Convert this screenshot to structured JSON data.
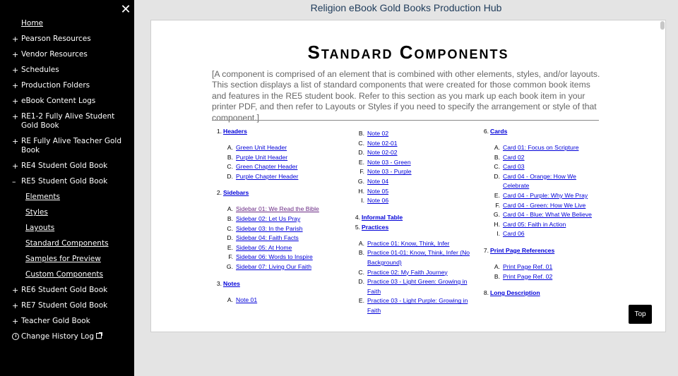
{
  "sidebar": {
    "close_label": "✕",
    "items": [
      {
        "label": "Home",
        "mark": ""
      },
      {
        "label": "Pearson Resources",
        "mark": "+"
      },
      {
        "label": "Vendor Resources",
        "mark": "+"
      },
      {
        "label": "Schedules",
        "mark": "+"
      },
      {
        "label": "Production Folders",
        "mark": "+"
      },
      {
        "label": "eBook Content Logs",
        "mark": "+"
      },
      {
        "label": "RE1-2 Fully Alive Student Gold Book",
        "mark": "+"
      },
      {
        "label": "RE Fully Alive Teacher Gold Book",
        "mark": "+"
      },
      {
        "label": "RE4 Student Gold Book",
        "mark": "+"
      },
      {
        "label": "RE5 Student Gold Book",
        "mark": "–"
      },
      {
        "label": "RE6 Student Gold Book",
        "mark": "+"
      },
      {
        "label": "RE7 Student Gold Book",
        "mark": "+"
      },
      {
        "label": "Teacher Gold Book",
        "mark": "+"
      },
      {
        "label": "Change History Log",
        "mark": ""
      }
    ],
    "re5_sub": [
      "Elements",
      "Styles",
      "Layouts",
      "Standard Components",
      "Samples for Preview",
      "Custom Components"
    ]
  },
  "header": {
    "title": "Religion eBook Gold Books Production Hub"
  },
  "main": {
    "title": "Standard Components",
    "intro": "[A component is comprised of an element that is combined with other elements, styles, and/or layouts. This section displays a list of standard components that were created for those common book items and features in the RE5 student book. Refer to this section as you mark up each book item in your printer PDF, and then refer to Layouts or Styles if you need to specify the arrangement or style of that component.]",
    "col1": {
      "s1": {
        "num": "1.",
        "title": "Headers",
        "items": [
          [
            "A.",
            "Green Unit Header"
          ],
          [
            "B.",
            "Purple Unit Header"
          ],
          [
            "C.",
            "Green Chapter Header"
          ],
          [
            "D.",
            "Purple Chapter Header"
          ]
        ]
      },
      "s2": {
        "num": "2.",
        "title": "Sidebars",
        "items": [
          [
            "A.",
            "Sidebar 01: We Read the Bible"
          ],
          [
            "B.",
            "Sidebar 02: Let Us Pray"
          ],
          [
            "C.",
            "Sidebar 03: In the Parish"
          ],
          [
            "D.",
            "Sidebar 04: Faith Facts"
          ],
          [
            "E.",
            "Sidebar 05: At Home"
          ],
          [
            "F.",
            "Sidebar 06: Words to Inspire"
          ],
          [
            "G.",
            "Sidebar 07: Living Our Faith"
          ]
        ]
      },
      "s3": {
        "num": "3.",
        "title": "Notes",
        "items": [
          [
            "A.",
            "Note 01"
          ]
        ]
      }
    },
    "col2": {
      "notes": [
        [
          "B.",
          "Note 02"
        ],
        [
          "C.",
          "Note 02-01"
        ],
        [
          "D.",
          "Note 02-02"
        ],
        [
          "E.",
          "Note 03 - Green"
        ],
        [
          "F.",
          "Note 03 - Purple"
        ],
        [
          "G.",
          "Note 04"
        ],
        [
          "H.",
          "Note 05"
        ],
        [
          "I.",
          "Note 06"
        ]
      ],
      "s4": {
        "num": "4.",
        "title": "Informal Table"
      },
      "s5": {
        "num": "5.",
        "title": "Practices",
        "items": [
          [
            "A.",
            "Practice 01: Know, Think, Infer"
          ],
          [
            "B.",
            "Practice 01-01: Know, Think, Infer (No Background)"
          ],
          [
            "C.",
            "Practice 02: My Faith Journey"
          ],
          [
            "D.",
            "Practice 03 - Light Green: Growing in Faith"
          ],
          [
            "E.",
            "Practice 03 - Light Purple: Growing in Faith"
          ]
        ]
      }
    },
    "col3": {
      "s6": {
        "num": "6.",
        "title": "Cards",
        "items": [
          [
            "A.",
            "Card 01: Focus on Scripture"
          ],
          [
            "B.",
            "Card 02"
          ],
          [
            "C.",
            "Card 03"
          ],
          [
            "D.",
            "Card 04 - Orange: How We Celebrate"
          ],
          [
            "E.",
            "Card 04 - Purple: Why We Pray"
          ],
          [
            "F.",
            "Card 04 - Green: How We Live"
          ],
          [
            "G.",
            "Card 04 - Blue: What We Believe"
          ],
          [
            "H.",
            "Card 05: Faith in Action"
          ],
          [
            "I.",
            "Card 06"
          ]
        ]
      },
      "s7": {
        "num": "7.",
        "title": "Print Page References",
        "items": [
          [
            "A.",
            "Print Page Ref. 01"
          ],
          [
            "B.",
            "Print Page Ref. 02"
          ]
        ]
      },
      "s8": {
        "num": "8.",
        "title": "Long Description"
      }
    }
  },
  "top_button": {
    "label": "Top"
  }
}
